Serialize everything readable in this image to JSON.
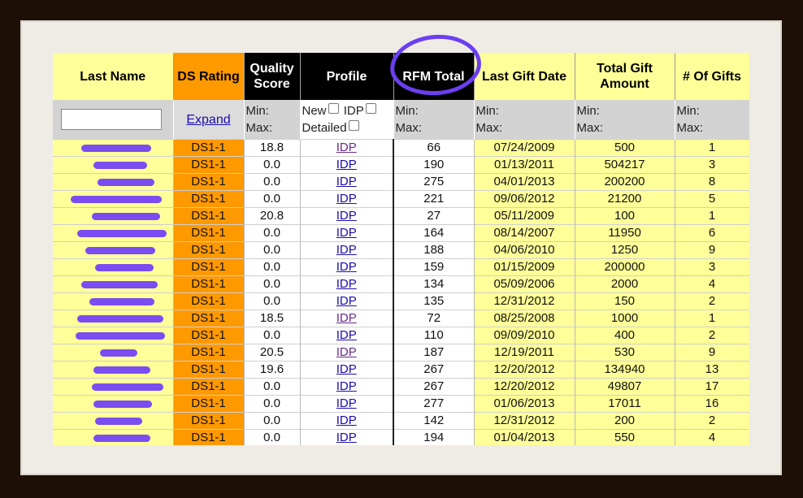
{
  "headers": {
    "last_name": "Last Name",
    "ds_rating": "DS Rating",
    "quality_score": "Quality Score",
    "profile": "Profile",
    "rfm_total": "RFM Total",
    "last_gift_date": "Last Gift Date",
    "total_gift_amount": "Total Gift Amount",
    "num_gifts": "# Of Gifts"
  },
  "filters": {
    "expand": "Expand",
    "min": "Min:",
    "max": "Max:",
    "new": "New",
    "idp": "IDP",
    "detailed": "Detailed",
    "name_value": ""
  },
  "rows": [
    {
      "name": "",
      "ds": "DS1-1",
      "q": "18.8",
      "p": "IDP",
      "rfm": "66",
      "date": "07/24/2009",
      "amt": "500",
      "gifts": "1"
    },
    {
      "name": "",
      "ds": "DS1-1",
      "q": "0.0",
      "p": "IDP",
      "rfm": "190",
      "date": "01/13/2011",
      "amt": "504217",
      "gifts": "3"
    },
    {
      "name": "",
      "ds": "DS1-1",
      "q": "0.0",
      "p": "IDP",
      "rfm": "275",
      "date": "04/01/2013",
      "amt": "200200",
      "gifts": "8"
    },
    {
      "name": "",
      "ds": "DS1-1",
      "q": "0.0",
      "p": "IDP",
      "rfm": "221",
      "date": "09/06/2012",
      "amt": "21200",
      "gifts": "5"
    },
    {
      "name": "",
      "ds": "DS1-1",
      "q": "20.8",
      "p": "IDP",
      "rfm": "27",
      "date": "05/11/2009",
      "amt": "100",
      "gifts": "1"
    },
    {
      "name": "",
      "ds": "DS1-1",
      "q": "0.0",
      "p": "IDP",
      "rfm": "164",
      "date": "08/14/2007",
      "amt": "11950",
      "gifts": "6"
    },
    {
      "name": "",
      "ds": "DS1-1",
      "q": "0.0",
      "p": "IDP",
      "rfm": "188",
      "date": "04/06/2010",
      "amt": "1250",
      "gifts": "9"
    },
    {
      "name": "",
      "ds": "DS1-1",
      "q": "0.0",
      "p": "IDP",
      "rfm": "159",
      "date": "01/15/2009",
      "amt": "200000",
      "gifts": "3"
    },
    {
      "name": "",
      "ds": "DS1-1",
      "q": "0.0",
      "p": "IDP",
      "rfm": "134",
      "date": "05/09/2006",
      "amt": "2000",
      "gifts": "4"
    },
    {
      "name": "",
      "ds": "DS1-1",
      "q": "0.0",
      "p": "IDP",
      "rfm": "135",
      "date": "12/31/2012",
      "amt": "150",
      "gifts": "2"
    },
    {
      "name": "",
      "ds": "DS1-1",
      "q": "18.5",
      "p": "IDP",
      "rfm": "72",
      "date": "08/25/2008",
      "amt": "1000",
      "gifts": "1"
    },
    {
      "name": "",
      "ds": "DS1-1",
      "q": "0.0",
      "p": "IDP",
      "rfm": "110",
      "date": "09/09/2010",
      "amt": "400",
      "gifts": "2"
    },
    {
      "name": "",
      "ds": "DS1-1",
      "q": "20.5",
      "p": "IDP",
      "rfm": "187",
      "date": "12/19/2011",
      "amt": "530",
      "gifts": "9"
    },
    {
      "name": "",
      "ds": "DS1-1",
      "q": "19.6",
      "p": "IDP",
      "rfm": "267",
      "date": "12/20/2012",
      "amt": "134940",
      "gifts": "13"
    },
    {
      "name": "",
      "ds": "DS1-1",
      "q": "0.0",
      "p": "IDP",
      "rfm": "267",
      "date": "12/20/2012",
      "amt": "49807",
      "gifts": "17"
    },
    {
      "name": "",
      "ds": "DS1-1",
      "q": "0.0",
      "p": "IDP",
      "rfm": "277",
      "date": "01/06/2013",
      "amt": "17011",
      "gifts": "16"
    },
    {
      "name": "",
      "ds": "DS1-1",
      "q": "0.0",
      "p": "IDP",
      "rfm": "142",
      "date": "12/31/2012",
      "amt": "200",
      "gifts": "2"
    },
    {
      "name": "",
      "ds": "DS1-1",
      "q": "0.0",
      "p": "IDP",
      "rfm": "194",
      "date": "01/04/2013",
      "amt": "550",
      "gifts": "4"
    }
  ],
  "colors": {
    "header_yellow": "#ffff99",
    "ds_orange": "#ff9900",
    "highlight_circle": "#6b3ff0",
    "link_blue": "#1a0dab",
    "link_visited": "#6b2a8a"
  }
}
